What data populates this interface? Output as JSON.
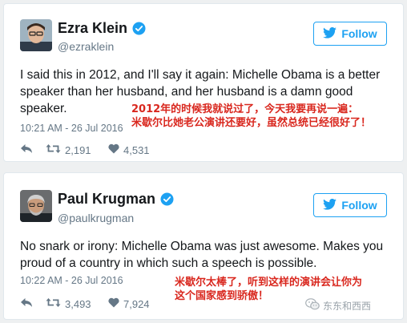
{
  "tweets": [
    {
      "name": "Ezra Klein",
      "handle": "@ezraklein",
      "follow_label": "Follow",
      "text": "I said this in 2012, and I'll say it again: Michelle Obama is a better speaker than her husband, and her husband is a damn good speaker.",
      "timestamp": "10:21 AM - 26 Jul 2016",
      "retweets": "2,191",
      "likes": "4,531",
      "annotation_line1": "2012年的时候我就说过了，今天我要再说一遍：",
      "annotation_line2": "米歇尔比她老公演讲还要好，虽然总统已经很好了！"
    },
    {
      "name": "Paul Krugman",
      "handle": "@paulkrugman",
      "follow_label": "Follow",
      "text": "No snark or irony: Michelle Obama was just awesome. Makes you proud of a country in which such a speech is possible.",
      "timestamp": "10:22 AM - 26 Jul 2016",
      "retweets": "3,493",
      "likes": "7,924",
      "annotation_line1": "米歇尔太棒了，听到这样的演讲会让你为",
      "annotation_line2": "这个国家感到骄傲！"
    }
  ],
  "watermark": {
    "text": "东东和西西",
    "icon": "wechat-icon"
  },
  "colors": {
    "twitter_blue": "#1da1f2",
    "text": "#14171a",
    "muted": "#657786",
    "annotation_red": "#d9271e"
  },
  "icons": {
    "verified": "verified-badge-icon",
    "follow": "twitter-bird-icon",
    "reply": "reply-icon",
    "retweet": "retweet-icon",
    "like": "heart-icon"
  }
}
